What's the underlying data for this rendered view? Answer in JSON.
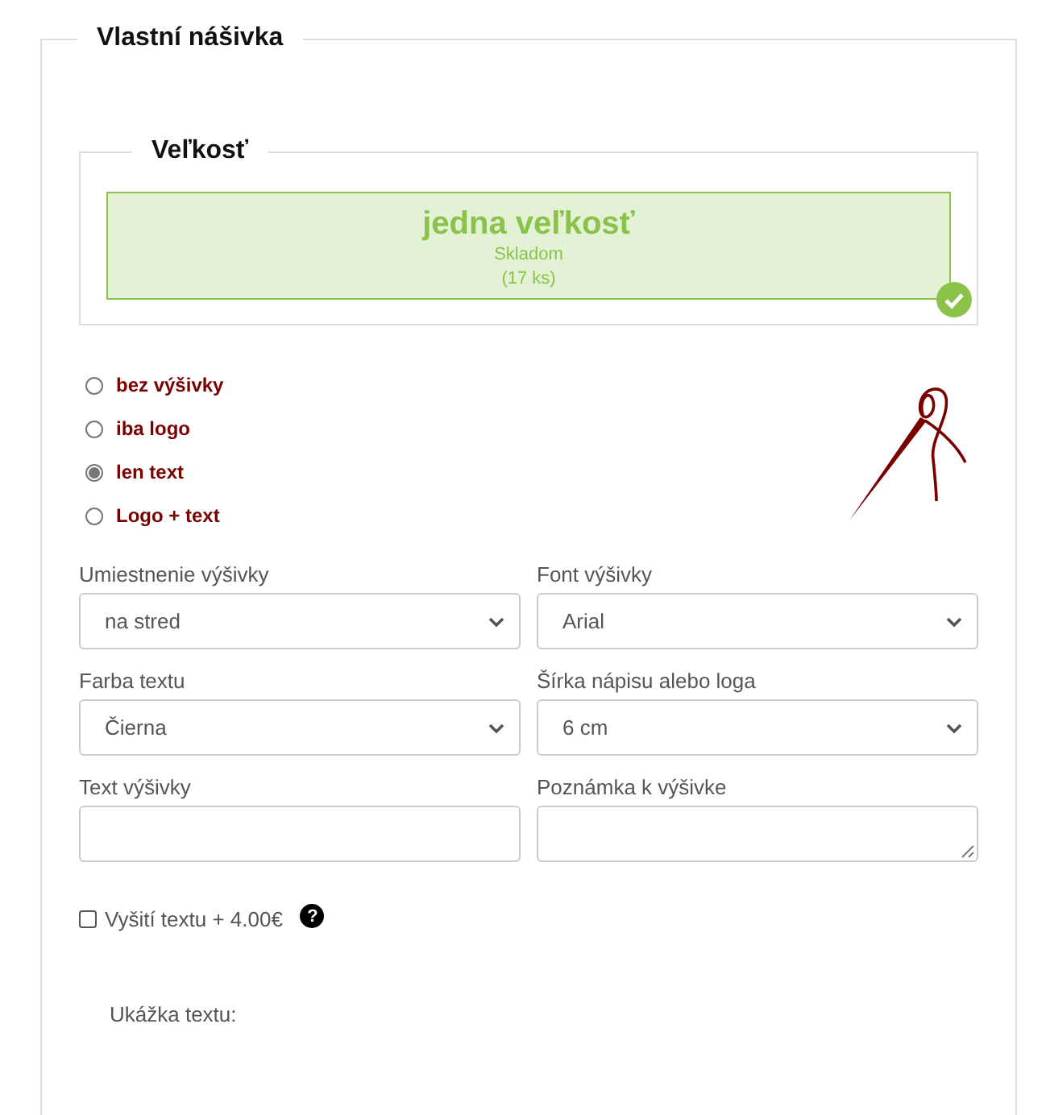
{
  "section": {
    "title": "Vlastní nášivka"
  },
  "size": {
    "title": "Veľkosť",
    "option": {
      "label": "jedna veľkosť",
      "stock": "Skladom",
      "count": "(17 ks)",
      "selected": true
    }
  },
  "embroidery_types": [
    {
      "label": "bez výšivky",
      "selected": false
    },
    {
      "label": "iba logo",
      "selected": false
    },
    {
      "label": "len text",
      "selected": true
    },
    {
      "label": "Logo + text",
      "selected": false
    }
  ],
  "fields": [
    {
      "label": "Umiestnenie výšivky",
      "kind": "select",
      "value": "na stred"
    },
    {
      "label": "Font výšivky",
      "kind": "select",
      "value": "Arial"
    },
    {
      "label": "Farba textu",
      "kind": "select",
      "value": "Čierna"
    },
    {
      "label": "Šírka nápisu alebo loga",
      "kind": "select",
      "value": "6 cm"
    },
    {
      "label": "Text výšivky",
      "kind": "input"
    },
    {
      "label": "Poznámka k výšivke",
      "kind": "textarea"
    }
  ],
  "text_surcharge": {
    "label": "Vyšití textu + 4.00€",
    "checked": false,
    "help": "?"
  },
  "preview": {
    "label": "Ukážka textu:"
  }
}
